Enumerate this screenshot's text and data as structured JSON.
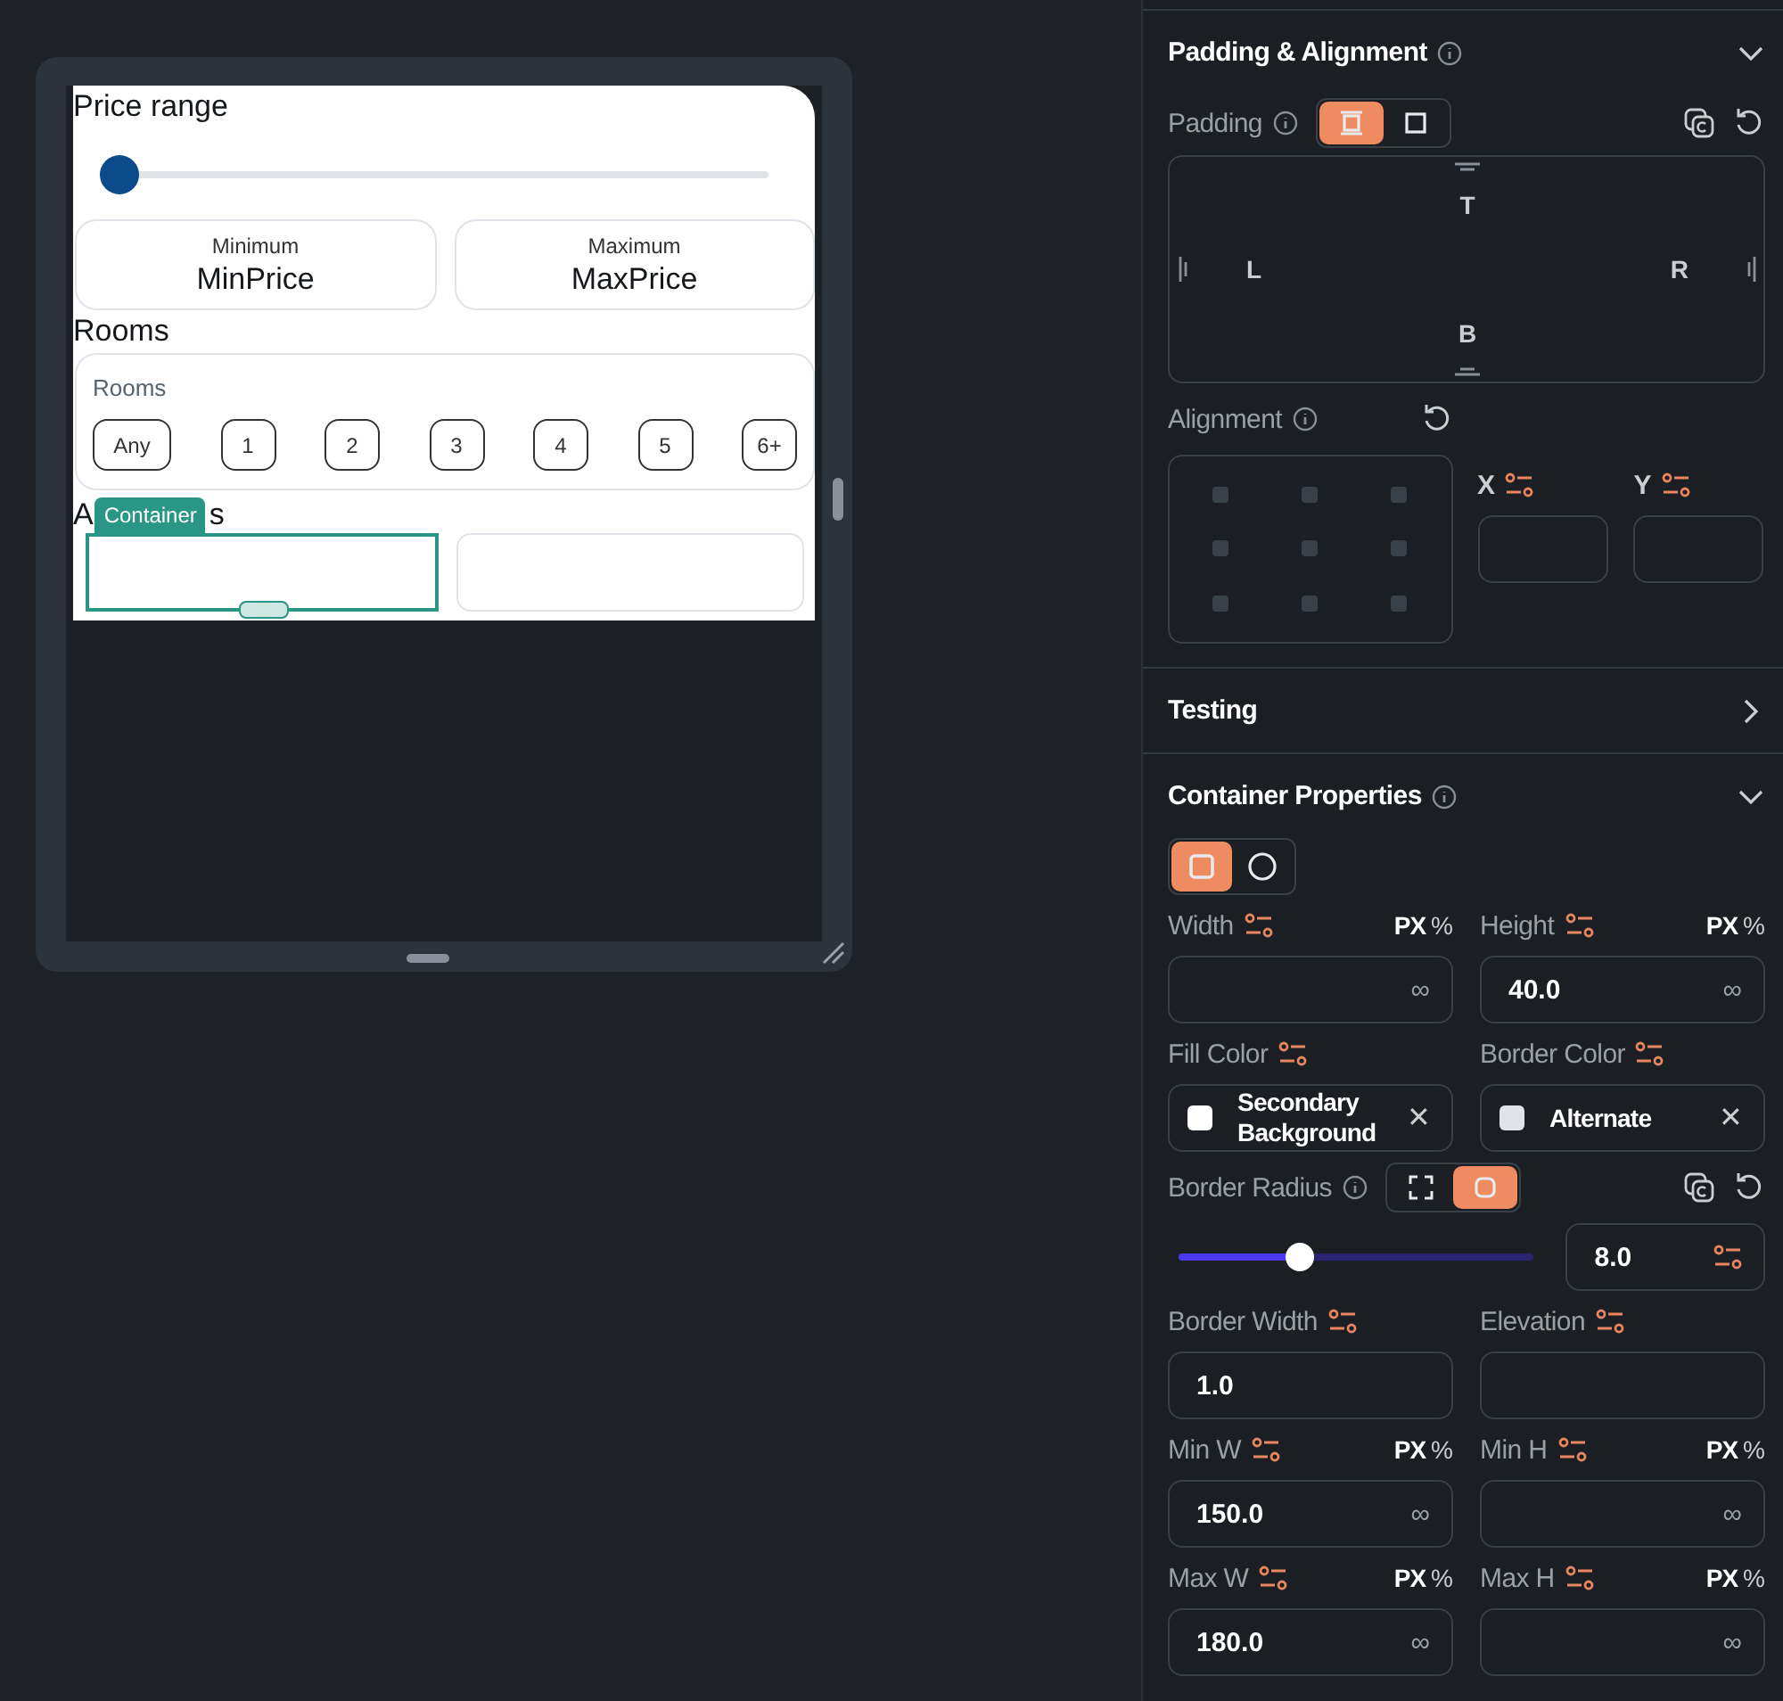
{
  "preview": {
    "price_title": "Price range",
    "price_slider": {
      "level": 0
    },
    "price_fields": [
      {
        "label": "Minimum",
        "value": "MinPrice"
      },
      {
        "label": "Maximum",
        "value": "MaxPrice"
      }
    ],
    "rooms_title": "Rooms",
    "rooms_card_label": "Rooms",
    "room_options": [
      {
        "label": "Any",
        "selected": false
      },
      {
        "label": "1",
        "selected": false
      },
      {
        "label": "2",
        "selected": false
      },
      {
        "label": "3",
        "selected": false
      },
      {
        "label": "4",
        "selected": false
      },
      {
        "label": "5",
        "selected": false
      },
      {
        "label": "6+",
        "selected": false
      }
    ],
    "amenities_start": "A",
    "amenities_end": "s",
    "selection_tag": "Container",
    "containers": [
      {
        "selected": true
      },
      {
        "selected": false
      }
    ]
  },
  "panel": {
    "padding_alignment": {
      "title": "Padding & Alignment",
      "expanded": true,
      "padding_label": "Padding",
      "padding_modes": [
        {
          "kind": "sides",
          "selected": true
        },
        {
          "kind": "all",
          "selected": false
        }
      ],
      "sides": {
        "top": "T",
        "left": "L",
        "right": "R",
        "bottom": "B"
      },
      "alignment_label": "Alignment",
      "x_label": "X",
      "y_label": "Y"
    },
    "testing": {
      "title": "Testing",
      "expanded": false
    },
    "container_properties": {
      "title": "Container Properties",
      "expanded": true,
      "shapes": [
        {
          "kind": "rect",
          "selected": true
        },
        {
          "kind": "circle",
          "selected": false
        }
      ],
      "rows": [
        [
          {
            "kind": "number",
            "label": "Width",
            "px": "PX",
            "pct": "%",
            "link": "∞"
          },
          {
            "kind": "number",
            "label": "Height",
            "px": "PX",
            "pct": "%",
            "value": "40.0",
            "link": "∞"
          }
        ],
        [
          {
            "kind": "color",
            "label": "Fill Color",
            "value": "Secondary Background",
            "color": "#ffffff",
            "clear": "✕"
          },
          {
            "kind": "color",
            "label": "Border Color",
            "value": "Alternate",
            "color": "#e0e3e7",
            "clear": "✕"
          }
        ]
      ],
      "border_radius": {
        "label": "Border Radius",
        "modes": [
          {
            "kind": "corners",
            "selected": false
          },
          {
            "kind": "uniform",
            "selected": true
          }
        ],
        "level": 0.34,
        "value": "8.0"
      },
      "rows2": [
        [
          {
            "kind": "number",
            "label": "Border Width",
            "value": "1.0"
          },
          {
            "kind": "number",
            "label": "Elevation"
          }
        ],
        [
          {
            "kind": "number",
            "label": "Min W",
            "px": "PX",
            "pct": "%",
            "value": "150.0",
            "link": "∞"
          },
          {
            "kind": "number",
            "label": "Min H",
            "px": "PX",
            "pct": "%",
            "link": "∞"
          }
        ],
        [
          {
            "kind": "number",
            "label": "Max W",
            "px": "PX",
            "pct": "%",
            "value": "180.0",
            "link": "∞"
          },
          {
            "kind": "number",
            "label": "Max H",
            "px": "PX",
            "pct": "%",
            "link": "∞"
          }
        ]
      ]
    }
  }
}
